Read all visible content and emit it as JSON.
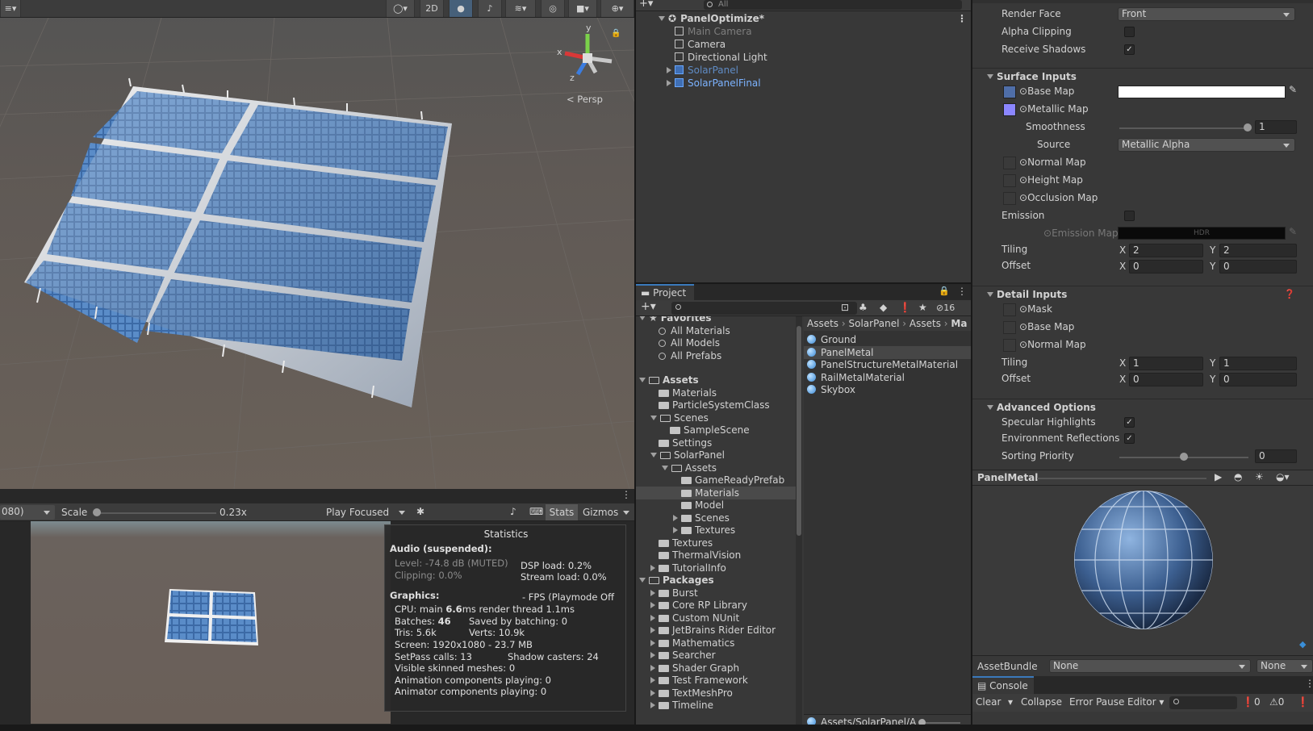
{
  "scene": {
    "toolbar": {
      "btn_2d": "2D"
    },
    "gizmo": {
      "axis_x": "x",
      "axis_y": "y",
      "axis_z": "z",
      "persp_label": "Persp"
    }
  },
  "hierarchy": {
    "search_placeholder": "All",
    "root": "PanelOptimize*",
    "items": [
      {
        "label": "Main Camera",
        "disabled": true
      },
      {
        "label": "Camera",
        "disabled": false
      },
      {
        "label": "Directional Light",
        "disabled": false
      },
      {
        "label": "SolarPanel",
        "disabled": true
      },
      {
        "label": "SolarPanelFinal",
        "disabled": false
      }
    ]
  },
  "project": {
    "tab": "Project",
    "hidden_count": "16",
    "breadcrumb": [
      "Assets",
      "SolarPanel",
      "Assets",
      "Ma"
    ],
    "favorites_label": "Favorites",
    "favorites": [
      "All Materials",
      "All Models",
      "All Prefabs"
    ],
    "assets_label": "Assets",
    "tree": [
      {
        "label": "Materials",
        "depth": 1,
        "arrow": "none"
      },
      {
        "label": "ParticleSystemClass",
        "depth": 1,
        "arrow": "none"
      },
      {
        "label": "Scenes",
        "depth": 1,
        "arrow": "down"
      },
      {
        "label": "SampleScene",
        "depth": 2,
        "arrow": "none"
      },
      {
        "label": "Settings",
        "depth": 1,
        "arrow": "none"
      },
      {
        "label": "SolarPanel",
        "depth": 1,
        "arrow": "down"
      },
      {
        "label": "Assets",
        "depth": 2,
        "arrow": "down"
      },
      {
        "label": "GameReadyPrefab",
        "depth": 3,
        "arrow": "none"
      },
      {
        "label": "Materials",
        "depth": 3,
        "arrow": "none"
      },
      {
        "label": "Model",
        "depth": 3,
        "arrow": "none"
      },
      {
        "label": "Scenes",
        "depth": 3,
        "arrow": "right"
      },
      {
        "label": "Textures",
        "depth": 3,
        "arrow": "right"
      },
      {
        "label": "Textures",
        "depth": 1,
        "arrow": "none"
      },
      {
        "label": "ThermalVision",
        "depth": 1,
        "arrow": "none"
      },
      {
        "label": "TutorialInfo",
        "depth": 1,
        "arrow": "right"
      }
    ],
    "packages_label": "Packages",
    "packages": [
      "Burst",
      "Core RP Library",
      "Custom NUnit",
      "JetBrains Rider Editor",
      "Mathematics",
      "Searcher",
      "Shader Graph",
      "Test Framework",
      "TextMeshPro",
      "Timeline"
    ],
    "files": [
      "Ground",
      "PanelMetal",
      "PanelStructureMetalMaterial",
      "RailMetalMaterial",
      "Skybox"
    ],
    "footer_path": "Assets/SolarPanel/A"
  },
  "inspector": {
    "render_face_label": "Render Face",
    "render_face_value": "Front",
    "alpha_clipping_label": "Alpha Clipping",
    "receive_shadows_label": "Receive Shadows",
    "surface_inputs": "Surface Inputs",
    "base_map": "Base Map",
    "metallic_map": "Metallic Map",
    "smoothness_label": "Smoothness",
    "smoothness_value": "1",
    "source_label": "Source",
    "source_value": "Metallic Alpha",
    "normal_map": "Normal Map",
    "height_map": "Height Map",
    "occlusion_map": "Occlusion Map",
    "emission": "Emission",
    "emission_map": "Emission Map",
    "hdr": "HDR",
    "tiling": "Tiling",
    "offset": "Offset",
    "x": "X",
    "y": "Y",
    "tiling_x": "2",
    "tiling_y": "2",
    "offset_x": "0",
    "offset_y": "0",
    "detail_inputs": "Detail Inputs",
    "mask": "Mask",
    "detail_base_map": "Base Map",
    "detail_normal_map": "Normal Map",
    "detail_tiling_x": "1",
    "detail_tiling_y": "1",
    "detail_offset_x": "0",
    "detail_offset_y": "0",
    "advanced_options": "Advanced Options",
    "specular_highlights": "Specular Highlights",
    "environment_reflections": "Environment Reflections",
    "sorting_priority": "Sorting Priority",
    "sorting_priority_value": "0",
    "preview_title": "PanelMetal",
    "assetbundle_label": "AssetBundle",
    "assetbundle_value": "None",
    "assetbundle_variant": "None"
  },
  "game": {
    "resolution": "080)",
    "scale_label": "Scale",
    "scale_value": "0.23x",
    "play_mode": "Play Focused",
    "stats_button": "Stats",
    "gizmos_button": "Gizmos"
  },
  "stats": {
    "title": "Statistics",
    "audio_header": "Audio (suspended):",
    "level": "Level: -74.8 dB (MUTED)",
    "clipping": "Clipping: 0.0%",
    "dsp_load": "DSP load: 0.2%",
    "stream_load": "Stream load: 0.0%",
    "graphics_header": "Graphics:",
    "fps": "- FPS (Playmode Off",
    "cpu_prefix": "CPU: main ",
    "cpu_main": "6.6",
    "cpu_suffix": "ms  render thread 1.1ms",
    "batches_prefix": "Batches: ",
    "batches": "46",
    "saved_by_batching": "Saved by batching: 0",
    "tris": "Tris: 5.6k",
    "verts": "Verts: 10.9k",
    "screen": "Screen: 1920x1080 - 23.7 MB",
    "setpass": "SetPass calls: 13",
    "shadow_casters": "Shadow casters: 24",
    "visible_skinned": "Visible skinned meshes: 0",
    "animation_components": "Animation components playing: 0",
    "animator_components": "Animator components playing: 0"
  },
  "console": {
    "tab": "Console",
    "clear": "Clear",
    "collapse": "Collapse",
    "error_pause": "Error Pause",
    "editor": "Editor",
    "warn_count": "0",
    "err_count": "0"
  }
}
